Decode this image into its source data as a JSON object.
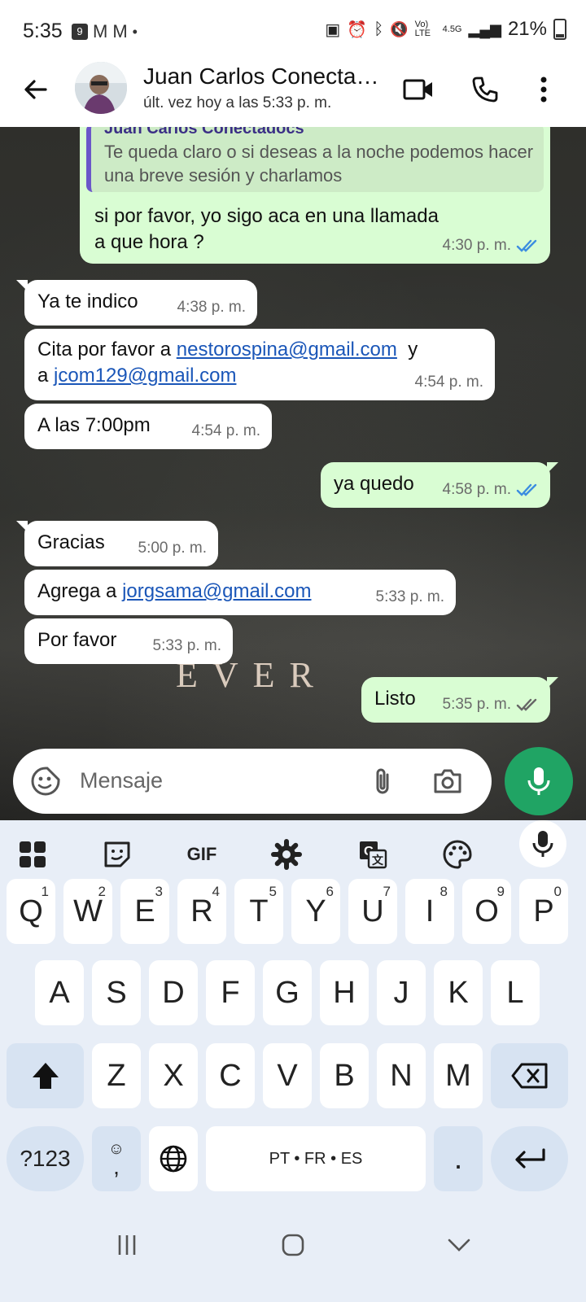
{
  "status_bar": {
    "time": "5:35",
    "battery": "21%",
    "network_label": "Vo) LTE",
    "network_gen": "4.5G"
  },
  "header": {
    "contact_name": "Juan Carlos Conecta…",
    "last_seen": "últ. vez hoy a las 5:33 p. m."
  },
  "messages": [
    {
      "id": "m1",
      "direction": "out",
      "quoted": {
        "name": "Juan Carlos Conectadocs",
        "text": "Te queda claro o si deseas a la noche podemos hacer una breve sesión y charlamos"
      },
      "line1": "si por favor, yo sigo aca en una llamada",
      "line2": "a que hora ?",
      "time": "4:30 p. m.",
      "status": "read"
    },
    {
      "id": "m2",
      "direction": "in",
      "text": "Ya te indico",
      "time": "4:38 p. m."
    },
    {
      "id": "m3",
      "direction": "in",
      "text_a": "Cita por favor a ",
      "link1": "nestorospina@gmail.com",
      "text_b": "  y",
      "text_c": "a ",
      "link2": "jcom129@gmail.com",
      "time": "4:54 p. m."
    },
    {
      "id": "m4",
      "direction": "in",
      "text": "A las 7:00pm",
      "time": "4:54 p. m."
    },
    {
      "id": "m5",
      "direction": "out",
      "text": "ya quedo",
      "time": "4:58 p. m.",
      "status": "read"
    },
    {
      "id": "m6",
      "direction": "in",
      "text": "Gracias",
      "time": "5:00 p. m."
    },
    {
      "id": "m7",
      "direction": "in",
      "text": "Agrega a ",
      "link": "jorgsama@gmail.com",
      "time": "5:33 p. m."
    },
    {
      "id": "m8",
      "direction": "in",
      "text": "Por favor",
      "time": "5:33 p. m."
    },
    {
      "id": "m9",
      "direction": "out",
      "text": "Listo",
      "time": "5:35 p. m.",
      "status": "delivered"
    }
  ],
  "wallpaper_text": "EVER",
  "composer": {
    "placeholder": "Mensaje"
  },
  "keyboard": {
    "toolbar": [
      "apps",
      "sticker",
      "GIF",
      "settings",
      "translate",
      "palette",
      "mic"
    ],
    "gif_label": "GIF",
    "row1": [
      {
        "key": "Q",
        "hint": "1"
      },
      {
        "key": "W",
        "hint": "2"
      },
      {
        "key": "E",
        "hint": "3"
      },
      {
        "key": "R",
        "hint": "4"
      },
      {
        "key": "T",
        "hint": "5"
      },
      {
        "key": "Y",
        "hint": "6"
      },
      {
        "key": "U",
        "hint": "7"
      },
      {
        "key": "I",
        "hint": "8"
      },
      {
        "key": "O",
        "hint": "9"
      },
      {
        "key": "P",
        "hint": "0"
      }
    ],
    "row2": [
      "A",
      "S",
      "D",
      "F",
      "G",
      "H",
      "J",
      "K",
      "L"
    ],
    "row3": [
      "Z",
      "X",
      "C",
      "V",
      "B",
      "N",
      "M"
    ],
    "symbols_label": "?123",
    "emoji_comma_label": ",",
    "space_label": "PT • FR • ES",
    "period_label": "."
  },
  "colors": {
    "outgoing_bubble": "#d9fdd3",
    "incoming_bubble": "#ffffff",
    "link": "#1a56b8",
    "read_tick": "#3c8de0",
    "mic_fab": "#20a464"
  }
}
